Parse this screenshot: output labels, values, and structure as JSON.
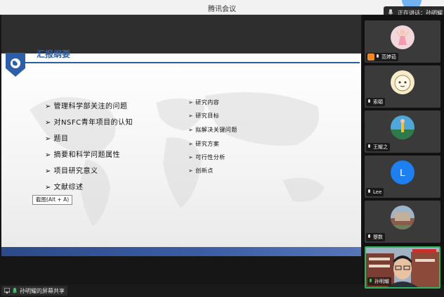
{
  "window": {
    "title": "腾讯会议"
  },
  "speaking": {
    "text": "正在讲话：孙明耀"
  },
  "slide": {
    "title": "汇报纲要",
    "left_items": [
      "➢ 管理科学部关注的问题",
      "➢ 对NSFC青年项目的认知",
      "➢ 题目",
      "➢ 摘要和科学问题属性",
      "➢ 项目研究意义",
      "➢ 文献综述"
    ],
    "right_items": [
      "➢ 研究内容",
      "➢ 研究目标",
      "➢ 拟解决关键问题",
      "➢ 研究方案",
      "➢ 可行性分析",
      "➢ 创新点"
    ]
  },
  "tooltip": {
    "text": "截图(Alt + A)"
  },
  "screen_share": {
    "label": "孙明耀的屏幕共享"
  },
  "participants": [
    {
      "name": "范婷茹",
      "host": true,
      "avatar": "girl-avatar"
    },
    {
      "name": "索頣",
      "host": false,
      "avatar": "cartoon-avatar"
    },
    {
      "name": "王耀之",
      "host": false,
      "avatar": "landscape-avatar"
    },
    {
      "name": "Lee",
      "host": false,
      "avatar": "letter-avatar",
      "letter": "L"
    },
    {
      "name": "曌数",
      "host": false,
      "avatar": "building-avatar"
    },
    {
      "name": "孙明耀",
      "host": false,
      "avatar": "camera-video",
      "active": true
    }
  ],
  "colors": {
    "accent": "#2d5ea8",
    "active_border": "#2fb35b",
    "mic": "#3cc36b"
  }
}
